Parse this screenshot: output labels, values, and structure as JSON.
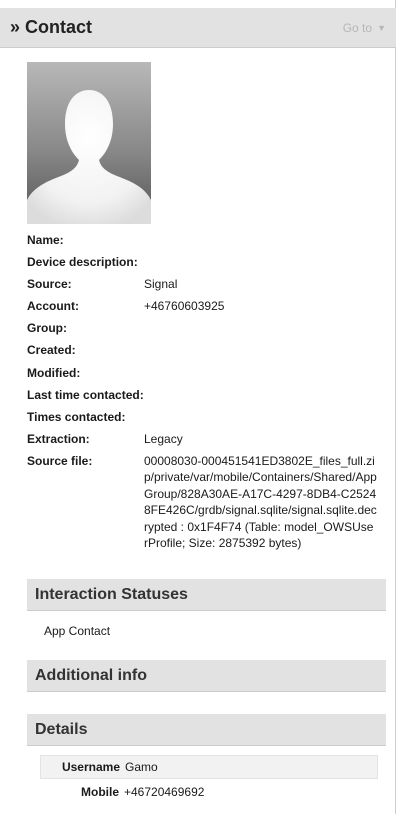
{
  "header": {
    "title": "Contact",
    "goto_label": "Go to"
  },
  "properties": [
    {
      "label": "Name:",
      "value": ""
    },
    {
      "label": "Device description:",
      "value": ""
    },
    {
      "label": "Source:",
      "value": "Signal"
    },
    {
      "label": "Account:",
      "value": "+46760603925"
    },
    {
      "label": "Group:",
      "value": ""
    },
    {
      "label": "Created:",
      "value": ""
    },
    {
      "label": "Modified:",
      "value": ""
    },
    {
      "label": "Last time contacted:",
      "value": ""
    },
    {
      "label": "Times contacted:",
      "value": ""
    },
    {
      "label": "Extraction:",
      "value": "Legacy"
    },
    {
      "label": "Source file:",
      "value": "00008030-000451541ED3802E_files_full.zip/private/var/mobile/Containers/Shared/AppGroup/828A30AE-A17C-4297-8DB4-C25248FE426C/grdb/signal.sqlite/signal.sqlite.decrypted : 0x1F4F74 (Table: model_OWSUserProfile; Size: 2875392 bytes)"
    }
  ],
  "sections": {
    "interaction": {
      "title": "Interaction Statuses",
      "items": [
        "App Contact"
      ]
    },
    "additional": {
      "title": "Additional info"
    },
    "details": {
      "title": "Details",
      "rows": [
        {
          "label": "Username",
          "value": "Gamo"
        },
        {
          "label": "Mobile",
          "value": "+46720469692"
        }
      ]
    }
  },
  "icons": {
    "avatar": "person-silhouette-icon",
    "collapse": "double-chevron-right-icon",
    "goto_caret": "caret-down-icon"
  },
  "colors": {
    "header_bg": "#e2e2e2",
    "goto_text": "#b6b6b6"
  }
}
